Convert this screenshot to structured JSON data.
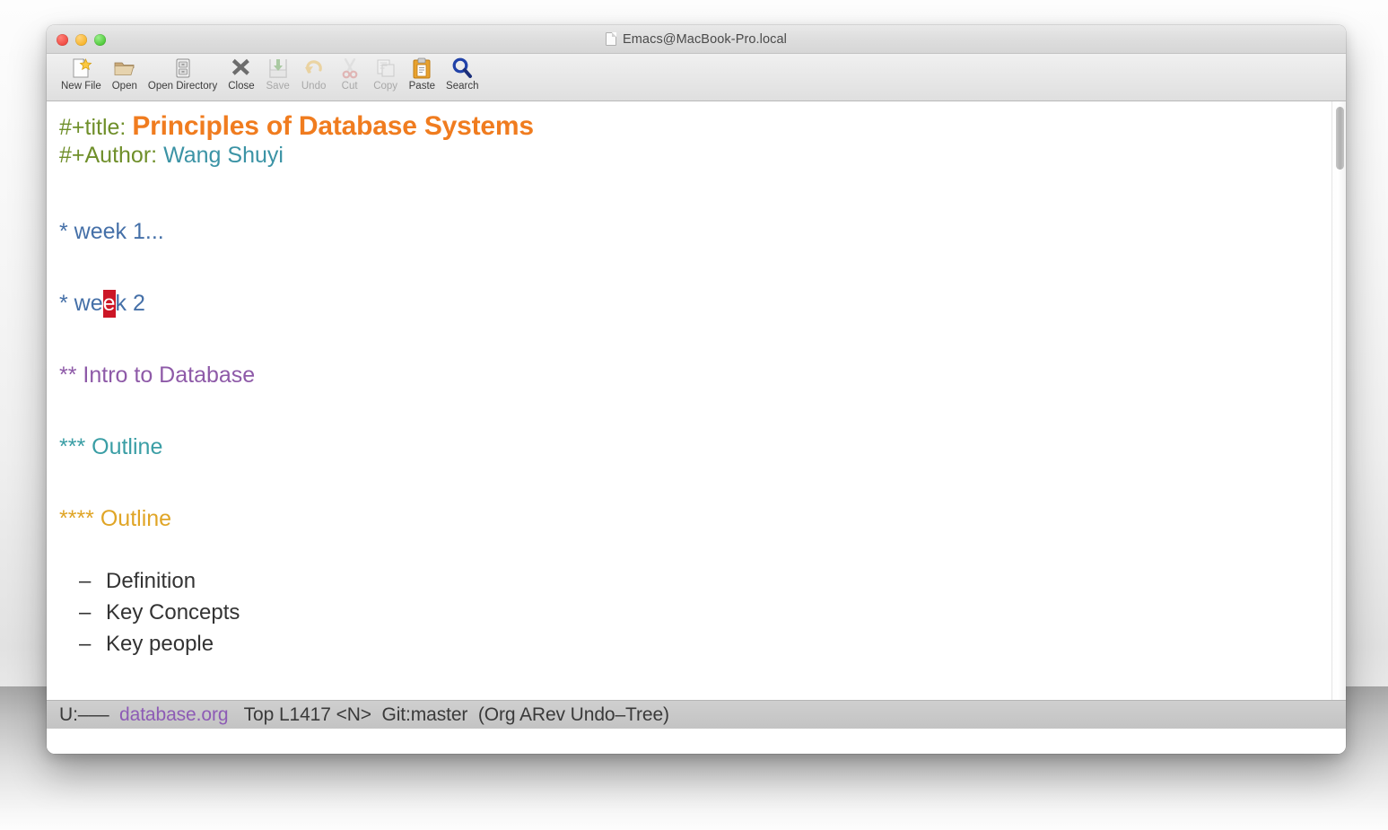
{
  "window": {
    "title": "Emacs@MacBook-Pro.local",
    "title_icon": "document-icon",
    "traffic_lights": [
      {
        "name": "close",
        "color": "#f04a42"
      },
      {
        "name": "minimize",
        "color": "#f7b52c"
      },
      {
        "name": "maximize",
        "color": "#4fc93a"
      }
    ]
  },
  "toolbar": {
    "items": [
      {
        "label": "New File",
        "icon": "new-file-icon",
        "enabled": true
      },
      {
        "label": "Open",
        "icon": "open-folder-icon",
        "enabled": true
      },
      {
        "label": "Open Directory",
        "icon": "open-directory-icon",
        "enabled": true
      },
      {
        "label": "Close",
        "icon": "close-x-icon",
        "enabled": true
      },
      {
        "label": "Save",
        "icon": "save-icon",
        "enabled": false
      },
      {
        "label": "Undo",
        "icon": "undo-arrow-icon",
        "enabled": false
      },
      {
        "label": "Cut",
        "icon": "scissors-icon",
        "enabled": false
      },
      {
        "label": "Copy",
        "icon": "copy-pages-icon",
        "enabled": false
      },
      {
        "label": "Paste",
        "icon": "clipboard-icon",
        "enabled": true
      },
      {
        "label": "Search",
        "icon": "magnifier-icon",
        "enabled": true
      }
    ]
  },
  "buffer": {
    "title_keyword": "#+title:",
    "title_value": "Principles of Database Systems",
    "author_keyword": "#+Author:",
    "author_value": "Wang Shuyi",
    "heading_week1": "* week 1...",
    "heading_week2_pre": "* we",
    "heading_week2_cursor": "e",
    "heading_week2_post": "k 2",
    "heading_intro": "** Intro to Database",
    "heading_outline3": "*** Outline",
    "heading_outline4": "**** Outline",
    "list": [
      {
        "bullet": "–",
        "text": "Definition"
      },
      {
        "bullet": "–",
        "text": "Key Concepts"
      },
      {
        "bullet": "–",
        "text": "Key people"
      }
    ]
  },
  "modeline": {
    "status": "U:–––",
    "file": "database.org",
    "position": "Top L1417 <N>",
    "vc": "Git:master",
    "modes": "(Org ARev Undo–Tree)"
  },
  "colors": {
    "title": "#f07c1f",
    "keyword": "#6f8f2a",
    "author": "#3b93a5",
    "level1": "#4570a8",
    "level2": "#8e5aa8",
    "level3": "#3a9ea5",
    "level4": "#e0a526",
    "cursor": "#cc1626",
    "modeline_file": "#8d5bb5",
    "body_text": "#333333"
  }
}
